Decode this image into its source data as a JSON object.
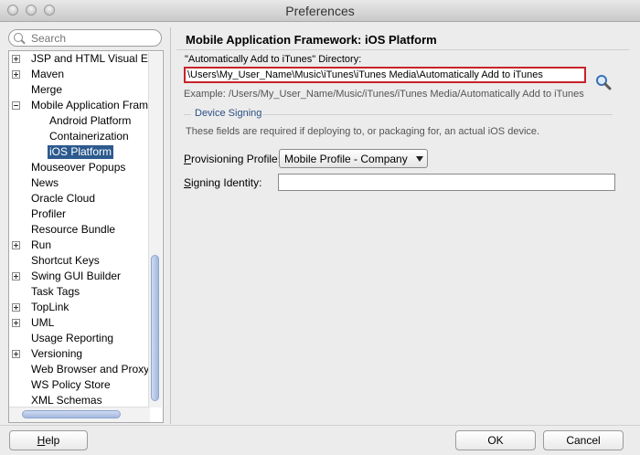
{
  "window": {
    "title": "Preferences"
  },
  "search": {
    "placeholder": "Search"
  },
  "tree": {
    "items": [
      {
        "label": "JSP and HTML Visual Edit",
        "expander": "plus"
      },
      {
        "label": "Maven",
        "expander": "plus"
      },
      {
        "label": "Merge",
        "expander": "none"
      },
      {
        "label": "Mobile Application Fram",
        "expander": "minus"
      },
      {
        "label": "Android Platform",
        "expander": "none"
      },
      {
        "label": "Containerization",
        "expander": "none"
      },
      {
        "label": "iOS Platform",
        "expander": "none",
        "selected": true
      },
      {
        "label": "Mouseover Popups",
        "expander": "none"
      },
      {
        "label": "News",
        "expander": "none"
      },
      {
        "label": "Oracle Cloud",
        "expander": "none"
      },
      {
        "label": "Profiler",
        "expander": "none"
      },
      {
        "label": "Resource Bundle",
        "expander": "none"
      },
      {
        "label": "Run",
        "expander": "plus"
      },
      {
        "label": "Shortcut Keys",
        "expander": "none"
      },
      {
        "label": "Swing GUI Builder",
        "expander": "plus"
      },
      {
        "label": "Task Tags",
        "expander": "none"
      },
      {
        "label": "TopLink",
        "expander": "plus"
      },
      {
        "label": "UML",
        "expander": "plus"
      },
      {
        "label": "Usage Reporting",
        "expander": "none"
      },
      {
        "label": "Versioning",
        "expander": "plus"
      },
      {
        "label": "Web Browser and Proxy",
        "expander": "none"
      },
      {
        "label": "WS Policy Store",
        "expander": "none"
      },
      {
        "label": "XML Schemas",
        "expander": "none"
      }
    ]
  },
  "main": {
    "heading": "Mobile Application Framework: iOS Platform",
    "itunes_dir": {
      "label": "\"Automatically Add to iTunes\" Directory:",
      "value": "\\Users\\My_User_Name\\Music\\iTunes\\iTunes Media\\Automatically Add to iTunes",
      "example": "Example: /Users/My_User_Name/Music/iTunes/iTunes Media/Automatically Add to iTunes"
    },
    "signing": {
      "section_title": "Device Signing",
      "note": "These fields are required if deploying to, or packaging for, an actual iOS device.",
      "provisioning_label_accel": "P",
      "provisioning_label_rest": "rovisioning Profile:",
      "provisioning_value": "Mobile Profile - Company",
      "identity_label_accel": "S",
      "identity_label_rest": "igning Identity:",
      "identity_value": ""
    }
  },
  "buttons": {
    "help_accel": "H",
    "help_rest": "elp",
    "ok": "OK",
    "cancel": "Cancel"
  },
  "colors": {
    "selection": "#2d5a8e",
    "required_border": "#c9222a",
    "section_title": "#2c4f85"
  },
  "icons": {
    "browse": "magnifier-icon",
    "search": "search-icon"
  }
}
